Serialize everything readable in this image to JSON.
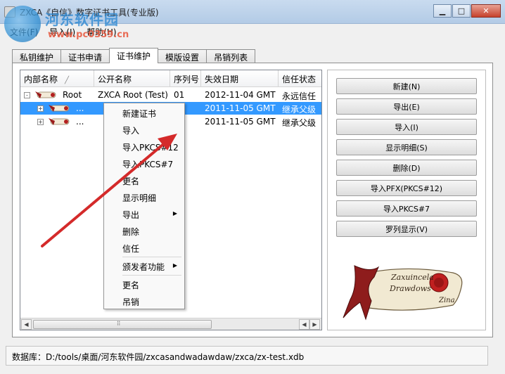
{
  "window": {
    "title": "ZXCA《自信》数字证书工具(专业版)",
    "controls": {
      "minimize": "▁",
      "maximize": "□",
      "close": "✕"
    }
  },
  "watermark": {
    "title": "河东软件园",
    "url": "www.pc0359.cn"
  },
  "menu": [
    "文件(F)",
    "导入(I)",
    "帮助(H)"
  ],
  "tabs": [
    "私钥维护",
    "证书申请",
    "证书维护",
    "模版设置",
    "吊销列表"
  ],
  "active_tab": 2,
  "tree": {
    "columns": [
      "内部名称",
      "公开名称",
      "序列号",
      "失效日期",
      "信任状态"
    ],
    "rows": [
      {
        "expander": "-",
        "name": "Root",
        "public": "ZXCA Root (Test)",
        "serial": "01",
        "expires": "2012-11-04 GMT",
        "trust": "永远信任",
        "selected": false
      },
      {
        "expander": "+",
        "name": "...",
        "public": "",
        "serial": "",
        "expires": "2011-11-05 GMT",
        "trust": "继承父级",
        "selected": true
      },
      {
        "expander": "+",
        "name": "...",
        "public": "",
        "serial": "",
        "expires": "2011-11-05 GMT",
        "trust": "继承父级",
        "selected": false
      }
    ],
    "scroll": {
      "left": "◀",
      "right": "▶",
      "grip": "⠿"
    }
  },
  "buttons": [
    "新建(N)",
    "导出(E)",
    "导入(I)",
    "显示明细(S)",
    "删除(D)",
    "导入PFX(PKCS#12)",
    "导入PKCS#7",
    "罗列显示(V)"
  ],
  "context_menu": [
    {
      "label": "新建证书"
    },
    {
      "label": "导入"
    },
    {
      "label": "导入PKCS#12"
    },
    {
      "label": "导入PKCS#7"
    },
    {
      "label": "更名"
    },
    {
      "label": "显示明细"
    },
    {
      "label": "导出",
      "submenu": true
    },
    {
      "label": "删除"
    },
    {
      "label": "信任"
    },
    {
      "label": "颁发者功能",
      "submenu": true,
      "separator_before": true
    },
    {
      "label": "更名",
      "separator_before": true
    },
    {
      "label": "吊销"
    }
  ],
  "logo_text": [
    "Zaxuincela",
    "Drawdows",
    "Zina"
  ],
  "status": "数据库：D:/tools/桌面/河东软件园/zxcasandwadawdaw/zxca/zx-test.xdb",
  "colors": {
    "selection": "#3399ff",
    "arrow": "#d42a2a",
    "ribbon": "#8e1c1c",
    "watermark": "#2e89d3"
  }
}
